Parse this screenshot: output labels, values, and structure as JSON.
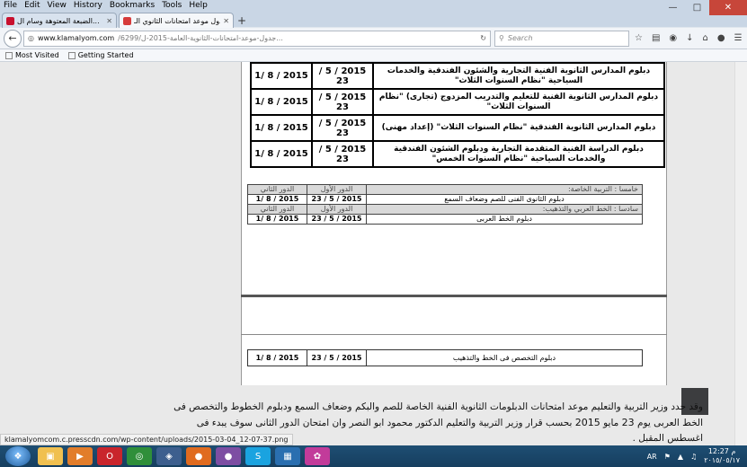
{
  "menu": {
    "items": [
      "File",
      "Edit",
      "View",
      "History",
      "Bookmarks",
      "Tools",
      "Help"
    ]
  },
  "tabs": [
    {
      "title": "الضبعة المعتوهة وسام ال...",
      "favicon_color": "#c8102e",
      "active": false
    },
    {
      "title": "جدول موعد امتحانات الثانوي الـ...",
      "favicon_color": "#d63b3b",
      "active": true
    }
  ],
  "nav": {
    "url_host": "www.klamalyom.com",
    "url_path": "/6299/جدول-موعد-امتحانات-الثانوية-العامة-2015-ل...",
    "search_placeholder": "Search"
  },
  "bookmarks": [
    "Most Visited",
    "Getting Started"
  ],
  "table1": {
    "rows": [
      {
        "desc": "دبلوم المدارس الثانوية الفنية التجارية والشئون الفندقية والخدمات السياحية \"نظام السنوات الثلاث\"",
        "first": "2015 / 5 / 23",
        "second": "2015 / 8 /1"
      },
      {
        "desc": "دبلوم المدارس الثانوية الفنية للتعليم والتدريب المزدوج (تجارى) \"نظام السنوات الثلاث\"",
        "first": "2015 / 5 / 23",
        "second": "2015 / 8 /1"
      },
      {
        "desc": "دبلوم المدارس الثانوية الفندقية \"نظام السنوات الثلاث\" (إعداد مهنى)",
        "first": "2015 / 5 / 23",
        "second": "2015 / 8 /1"
      },
      {
        "desc": "دبلوم الدراسة الفنية المتقدمة التجارية ودبلوم الشئون الفندقية والخدمات السياحية \"نظام السنوات الخمس\"",
        "first": "2015 / 5 / 23",
        "second": "2015 / 8 /1"
      }
    ]
  },
  "table2": {
    "sections": [
      {
        "title": "خامسا : التربية الخاصة:",
        "col_first": "الدور الأول",
        "col_second": "الدور الثاني",
        "row": {
          "desc": "دبلوم الثانوى الفنى للصم وضعاف السمع",
          "first": "2015 / 5 / 23",
          "second": "2015 / 8 /1"
        }
      },
      {
        "title": "سادسا : الخط العربي والتذهيب:",
        "col_first": "الدور الأول",
        "col_second": "الدور الثاني",
        "row": {
          "desc": "دبلوم الخط العربى",
          "first": "2015 / 5 / 23",
          "second": "2015 / 8 /1"
        }
      }
    ]
  },
  "table3": {
    "row": {
      "desc": "دبلوم التخصص فى الخط والتذهيب",
      "first": "2015 / 5 / 23",
      "second": "2015 / 8 /1"
    }
  },
  "article": {
    "line1": "وقد حدد وزير التربية والتعليم موعد امتحانات الدبلومات الثانوية الفنية الخاصة للصم والبكم وضعاف السمع ودبلوم الخطوط والتخصص فى",
    "line2a": "الخط العربى يوم",
    "line2_num": "23",
    "line2b": "مايو",
    "line2_year": "2015",
    "line2c": "بحسب قرار وزير التربية والتعليم الدكتور محمود ابو النصر وان امتحان الدور الثانى سوف يبدء فى",
    "line3": "اغسطس المقبل ."
  },
  "status": {
    "text": "klamalyomcom.c.presscdn.com/wp-content/uploads/2015-03-04_12-07-37.png"
  },
  "taskbar": {
    "lang": "AR",
    "time": "12:27 م",
    "date": "٢٠١٥/٠٥/١٧"
  }
}
